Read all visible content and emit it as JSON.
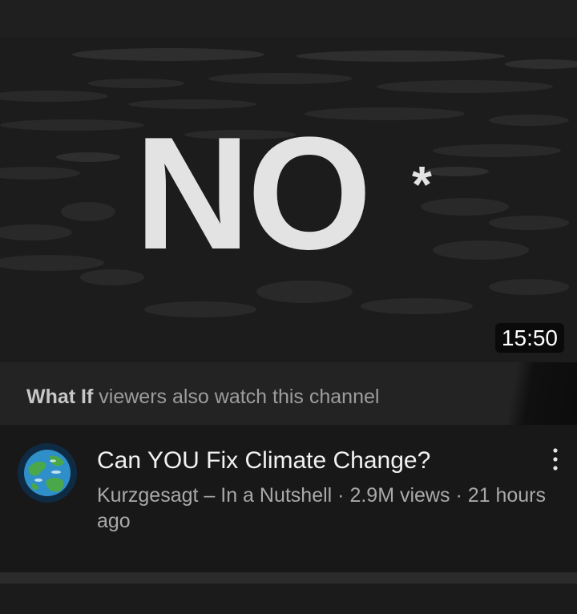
{
  "thumbnail": {
    "headline": "NO",
    "asterisk": "*",
    "duration": "15:50"
  },
  "banner": {
    "channel_name": "What If",
    "suffix": " viewers also watch this channel"
  },
  "video": {
    "title": "Can YOU Fix Climate Change?",
    "channel": "Kurzgesagt – In a Nutshell",
    "views": "2.9M views",
    "age": "21 hours ago",
    "more_icon": "more-vertical-icon"
  },
  "colors": {
    "background": "#181818",
    "banner": "#232323",
    "title_text": "#f1f1f1",
    "meta_text": "#a9a9a9",
    "avatar_planet_ocean": "#2f8fc8",
    "avatar_planet_land": "#4aa84a"
  }
}
